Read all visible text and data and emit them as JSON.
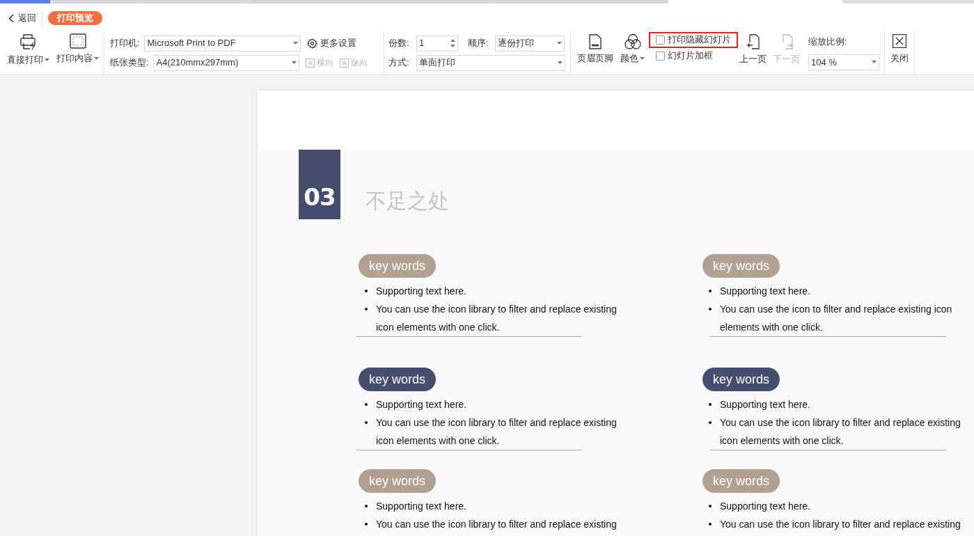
{
  "nav": {
    "back": "返回",
    "title": "打印预览"
  },
  "toolbar": {
    "print_buttons": [
      {
        "kind": "printer",
        "label": "直接打印"
      },
      {
        "kind": "content",
        "label": "打印内容"
      }
    ],
    "printer": {
      "label": "打印机:",
      "value": "Microsoft Print to PDF"
    },
    "more_settings": "更多设置",
    "paper": {
      "label": "纸张类型:",
      "value": "A4(210mmx297mm)"
    },
    "orientation": [
      {
        "label": "横向",
        "disabled": true
      },
      {
        "label": "纵向",
        "disabled": true
      }
    ],
    "copies": {
      "label": "份数:",
      "value": "1"
    },
    "order": {
      "label": "顺序:",
      "value": "逐份打印"
    },
    "mode": {
      "label": "方式:",
      "value": "单面打印"
    },
    "header_footer": "页眉页脚",
    "color_label": "颜色",
    "checkboxes": [
      {
        "label": "打印隐藏幻灯片",
        "checked": false,
        "highlighted": true
      },
      {
        "label": "幻灯片加框",
        "checked": false,
        "highlighted": false
      }
    ],
    "pager": [
      {
        "kind": "prev",
        "label": "上一页",
        "disabled": false
      },
      {
        "kind": "next",
        "label": "下一页",
        "disabled": true
      }
    ],
    "zoom": {
      "label": "缩放比例:",
      "value": "104 %"
    },
    "close": "关闭"
  },
  "slide": {
    "section_number": "03",
    "section_title": "不足之处",
    "items": [
      {
        "label": "key words",
        "color": "#b0a193",
        "bullets": [
          "Supporting text here.",
          "You can use the icon library to filter and replace existing icon elements with one click."
        ]
      },
      {
        "label": "key words",
        "color": "#b0a193",
        "bullets": [
          "Supporting text here.",
          "You can use the icon to filter and replace existing icon elements with one click."
        ]
      },
      {
        "label": "key words",
        "color": "#454e6c",
        "bullets": [
          "Supporting text here.",
          "You can use the icon library to filter and replace existing icon elements with one click."
        ]
      },
      {
        "label": "key words",
        "color": "#454e6c",
        "bullets": [
          "Supporting text here.",
          "You can use the icon library to filter and replace existing icon elements with one click."
        ]
      },
      {
        "label": "key words",
        "color": "#b0a193",
        "bullets": [
          "Supporting text here.",
          "You can use the icon library to filter and replace existing"
        ]
      },
      {
        "label": "key words",
        "color": "#b0a193",
        "bullets": [
          "Supporting text here.",
          "You can use the icon library to filter and replace existing"
        ]
      }
    ]
  }
}
